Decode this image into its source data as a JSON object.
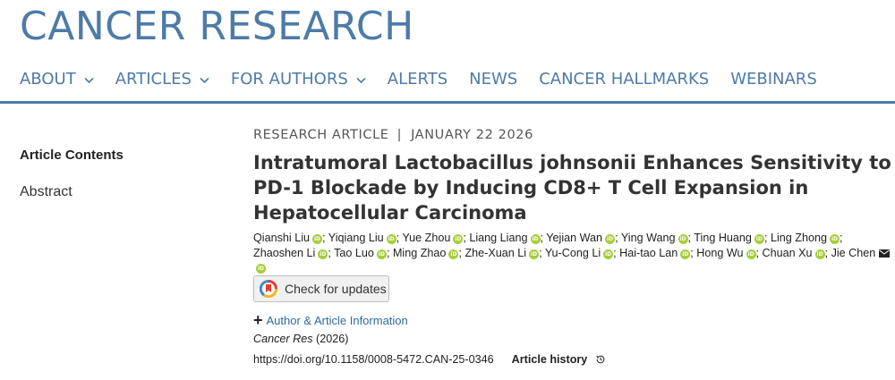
{
  "brand": {
    "title": "CANCER RESEARCH"
  },
  "nav": {
    "items": [
      {
        "label": "ABOUT",
        "dropdown": true
      },
      {
        "label": "ARTICLES",
        "dropdown": true
      },
      {
        "label": "FOR AUTHORS",
        "dropdown": true
      },
      {
        "label": "ALERTS",
        "dropdown": false
      },
      {
        "label": "NEWS",
        "dropdown": false
      },
      {
        "label": "CANCER HALLMARKS",
        "dropdown": false
      },
      {
        "label": "WEBINARS",
        "dropdown": false
      }
    ]
  },
  "sidebar": {
    "heading": "Article Contents",
    "links": [
      "Abstract"
    ]
  },
  "article": {
    "type": "RESEARCH ARTICLE",
    "separator": "|",
    "date": "JANUARY 22 2026",
    "title": "Intratumoral Lactobacillus johnsonii Enhances Sensitivity to PD-1 Blockade by Inducing CD8+ T Cell Expansion in Hepatocellular Carcinoma",
    "authors": [
      "Qianshi Liu",
      "Yiqiang Liu",
      "Yue Zhou",
      "Liang Liang",
      "Yejian Wan",
      "Ying Wang",
      "Ting Huang",
      "Ling Zhong",
      "Zhaoshen Li",
      "Tao Luo",
      "Ming Zhao",
      "Zhe-Xuan Li",
      "Yu-Cong Li",
      "Hai-tao Lan",
      "Hong Wu",
      "Chuan Xu",
      "Jie Chen"
    ],
    "author_separator": ";",
    "orcid_label": "iD",
    "check_updates": "Check for updates",
    "author_info": "Author & Article Information",
    "journal": "Cancer Res",
    "year": "(2026)",
    "doi": "https://doi.org/10.1158/0008-5472.CAN-25-0346",
    "history": "Article history"
  },
  "icons": {
    "orcid": "orcid-icon",
    "mail": "envelope-icon",
    "check": "crossmark-icon",
    "plus": "plus-icon",
    "history": "history-clock-icon",
    "chevron": "chevron-down-icon"
  },
  "colors": {
    "brand": "#4d7ba7",
    "orcid": "#a6ce39",
    "link": "#2e6aa0"
  }
}
